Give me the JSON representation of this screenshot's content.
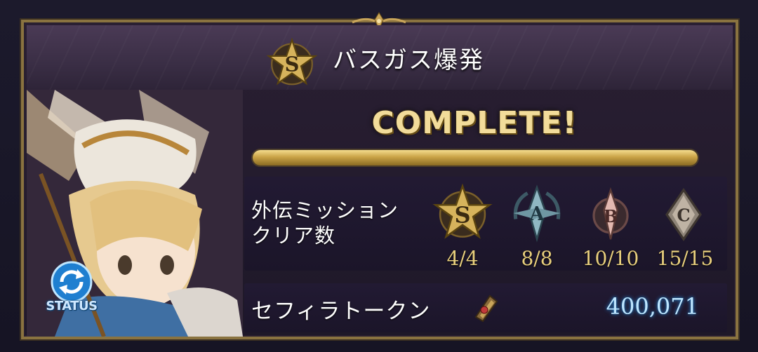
{
  "header": {
    "title": "バスガス爆発",
    "rank_icon": "s-rank-star-icon"
  },
  "status_button": {
    "label": "STATUS",
    "icon": "refresh-icon"
  },
  "progress": {
    "status_text": "COMPLETE!",
    "fraction": 1.0
  },
  "missions": {
    "label_line1": "外伝ミッション",
    "label_line2": "クリア数",
    "ranks": [
      {
        "rank": "S",
        "count": "4/4"
      },
      {
        "rank": "A",
        "count": "8/8"
      },
      {
        "rank": "B",
        "count": "10/10"
      },
      {
        "rank": "C",
        "count": "15/15"
      }
    ]
  },
  "token": {
    "label": "セフィラトークン",
    "icon": "sephira-token-icon",
    "value": "400,071"
  },
  "colors": {
    "gold": "#e8cf7d",
    "frame": "#8a7340",
    "token_value": "#bfe6ff",
    "status_blue": "#2a8fe0"
  }
}
